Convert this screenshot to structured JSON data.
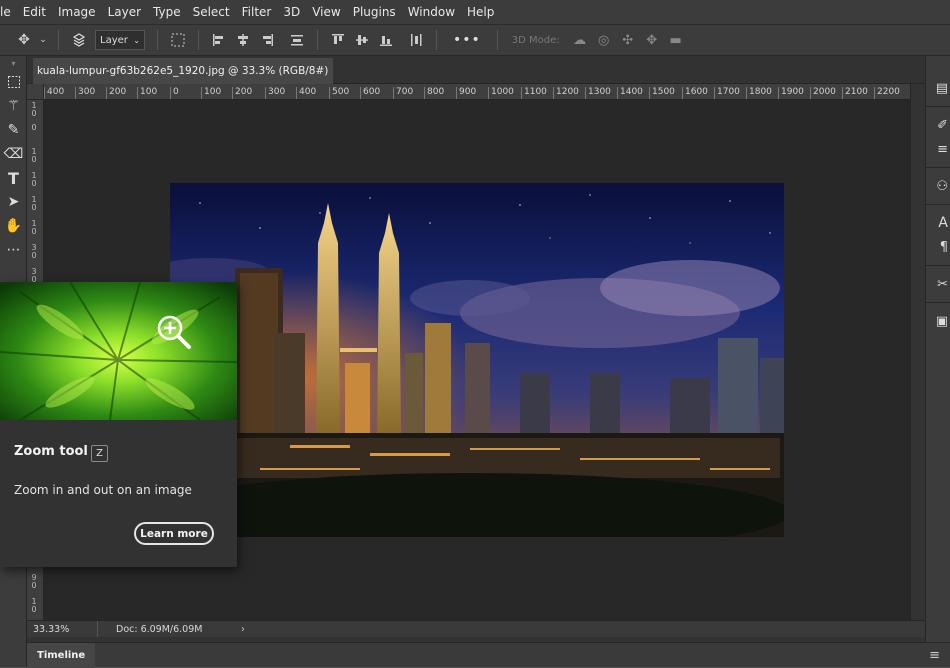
{
  "menu": [
    "le",
    "Edit",
    "Image",
    "Layer",
    "Type",
    "Select",
    "Filter",
    "3D",
    "View",
    "Plugins",
    "Window",
    "Help"
  ],
  "options_bar": {
    "move_icon": "move-icon",
    "layer_select": "Layer",
    "mode_3d_label": "3D Mode:",
    "more": "•••"
  },
  "document_tab": {
    "title": "kuala-lumpur-gf63b262e5_1920.jpg @ 33.3% (RGB/8#)",
    "close": "×"
  },
  "ruler_top": [
    "400",
    "300",
    "200",
    "100",
    "0",
    "100",
    "200",
    "300",
    "400",
    "500",
    "600",
    "700",
    "800",
    "900",
    "1000",
    "1100",
    "1200",
    "1300",
    "1400",
    "1500",
    "1600",
    "1700",
    "1800",
    "1900",
    "2000",
    "2100",
    "2200"
  ],
  "ruler_left": [
    "1 0",
    "0",
    "1 0",
    "1 0",
    "1 0",
    "1 0",
    "3 0",
    "3 0",
    "4 0",
    "4 0",
    "5 0",
    "5 0",
    "6 0",
    "6 0",
    "7 0",
    "8 0",
    "8 0",
    "9 0",
    "9 0",
    "1 0",
    "1 0",
    "1 0"
  ],
  "tooltip": {
    "title": "Zoom tool",
    "shortcut": "Z",
    "description": "Zoom in and out on an image",
    "button": "Learn more"
  },
  "status": {
    "zoom": "33.33%",
    "doc": "Doc: 6.09M/6.09M",
    "arrow": "›"
  },
  "timeline": {
    "tab": "Timeline",
    "menu_icon": "≡"
  },
  "colors": {
    "ui_dark": "#3c3c3c",
    "pasteboard": "#282828",
    "tooltip_bg": "#323232"
  }
}
